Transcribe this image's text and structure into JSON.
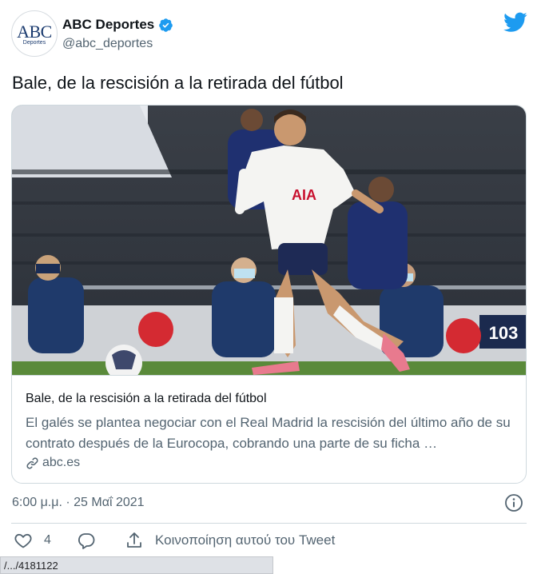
{
  "account": {
    "display_name": "ABC Deportes",
    "handle": "@abc_deportes",
    "avatar_logo_text": "ABC",
    "avatar_logo_subtext": "Deportes"
  },
  "tweet": {
    "text": "Bale, de la rescisión a la retirada del fútbol",
    "timestamp": "6:00 μ.μ. · 25 Μαΐ 2021"
  },
  "card": {
    "image_icon": "soccer-player-photo",
    "jersey_text": "AIA",
    "board_number": "103",
    "title": "Bale, de la rescisión a la retirada del fútbol",
    "description": "El galés se plantea negociar con el Real Madrid la rescisión del último año de su contrato después de la Eurocopa, cobrando una parte de su ficha …",
    "domain": "abc.es"
  },
  "actions": {
    "like_count": "4",
    "share_label": "Κοινοποίηση αυτού του Tweet"
  },
  "status_bar": {
    "url": "/.../4181122"
  },
  "colors": {
    "twitter_blue": "#1d9bf0",
    "secondary_text": "#536471",
    "border": "#cfd9de"
  }
}
